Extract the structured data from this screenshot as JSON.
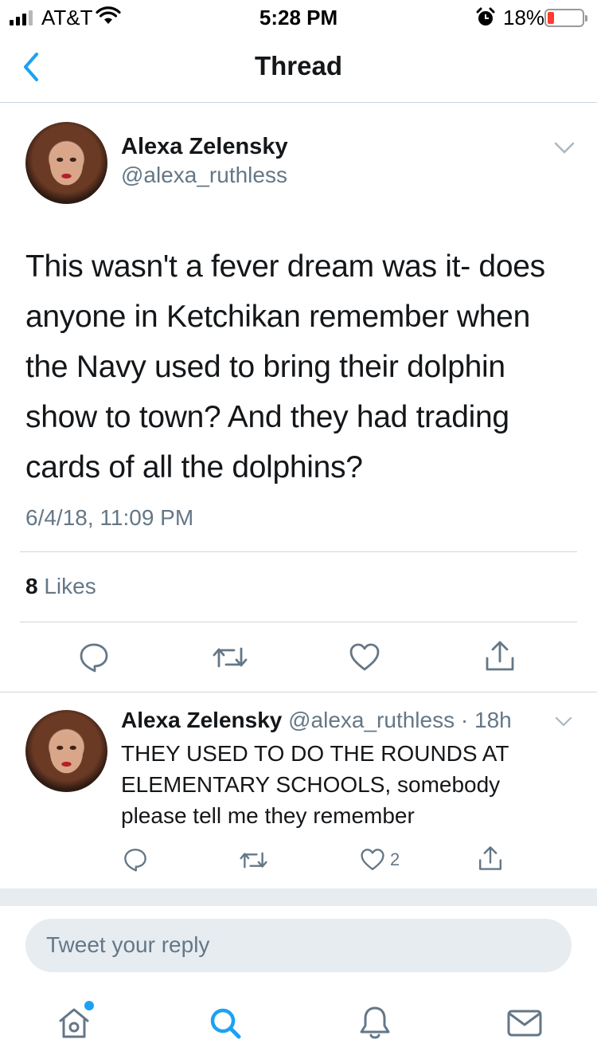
{
  "status_bar": {
    "carrier": "AT&T",
    "time": "5:28 PM",
    "battery_percent": "18%",
    "battery_level": 0.18,
    "icons": [
      "signal-icon",
      "wifi-icon",
      "alarm-icon",
      "battery-icon"
    ]
  },
  "nav": {
    "title": "Thread",
    "back_icon": "chevron-left-icon"
  },
  "main_tweet": {
    "author_name": "Alexa Zelensky",
    "author_handle": "@alexa_ruthless",
    "text": "This wasn't a fever dream was it- does anyone in Ketchikan remember when the Navy used to bring their dolphin show to town? And they had trading cards of all the dolphins?",
    "timestamp": "6/4/18, 11:09 PM",
    "likes_count": "8",
    "likes_label": "Likes",
    "actions": [
      "reply-icon",
      "retweet-icon",
      "like-icon",
      "share-icon"
    ]
  },
  "reply_tweet": {
    "author_name": "Alexa Zelensky",
    "author_handle": "@alexa_ruthless",
    "separator": "·",
    "age": "18h",
    "text": "THEY USED TO DO THE ROUNDS AT ELEMENTARY SCHOOLS, somebody please tell me they remember",
    "like_count": "2"
  },
  "composer": {
    "placeholder": "Tweet your reply"
  },
  "tab_bar": {
    "tabs": [
      "home-icon",
      "search-icon",
      "notifications-icon",
      "messages-icon"
    ],
    "active_tab": "search-icon",
    "accent_color": "#1da1f2"
  },
  "colors": {
    "accent": "#1da1f2",
    "text": "#14171a",
    "secondary_text": "#657786",
    "divider": "#ccd6dd",
    "battery_low": "#ff3b30"
  }
}
